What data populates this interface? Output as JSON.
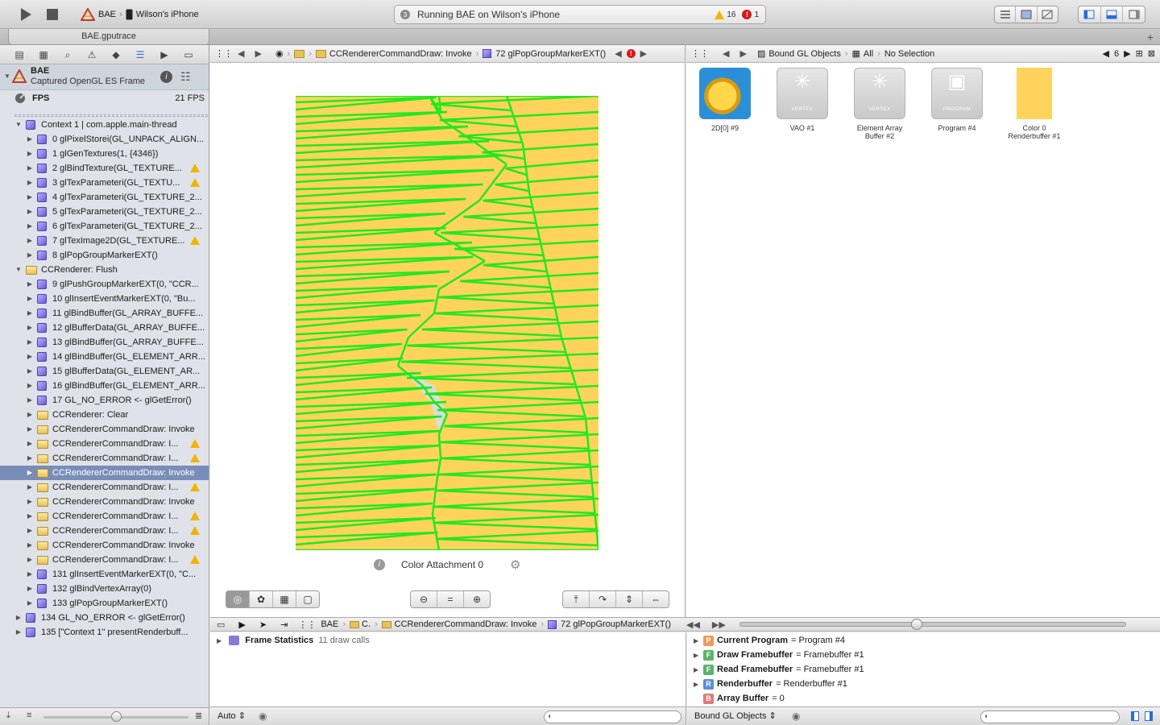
{
  "toolbar": {
    "scheme": "BAE",
    "device": "Wilson's iPhone",
    "activity": "Running BAE on Wilson's iPhone",
    "warnings": "16",
    "errors": "1"
  },
  "tab": {
    "title": "BAE.gputrace"
  },
  "navigator": {
    "app_name": "BAE",
    "subtitle": "Captured OpenGL ES Frame",
    "fps_label": "FPS",
    "fps_value": "21 FPS",
    "rows": [
      {
        "indent": 1,
        "kind": "context",
        "label": "Context 1 | com.apple.main-thread",
        "open": true
      },
      {
        "indent": 2,
        "kind": "call",
        "label": "0 glPixelStorei(GL_UNPACK_ALIGN...",
        "warn": false
      },
      {
        "indent": 2,
        "kind": "call",
        "label": "1 glGenTextures(1, {4346})",
        "warn": false
      },
      {
        "indent": 2,
        "kind": "call",
        "label": "2 glBindTexture(GL_TEXTURE...",
        "warn": true
      },
      {
        "indent": 2,
        "kind": "call",
        "label": "3 glTexParameteri(GL_TEXTU...",
        "warn": true
      },
      {
        "indent": 2,
        "kind": "call",
        "label": "4 glTexParameteri(GL_TEXTURE_2...",
        "warn": false
      },
      {
        "indent": 2,
        "kind": "call",
        "label": "5 glTexParameteri(GL_TEXTURE_2...",
        "warn": false
      },
      {
        "indent": 2,
        "kind": "call",
        "label": "6 glTexParameteri(GL_TEXTURE_2...",
        "warn": false
      },
      {
        "indent": 2,
        "kind": "call",
        "label": "7 glTexImage2D(GL_TEXTURE...",
        "warn": true
      },
      {
        "indent": 2,
        "kind": "call",
        "label": "8 glPopGroupMarkerEXT()",
        "warn": false
      },
      {
        "indent": 1,
        "kind": "group",
        "label": "CCRenderer: Flush",
        "open": true
      },
      {
        "indent": 2,
        "kind": "call",
        "label": "9 glPushGroupMarkerEXT(0, \"CCR...",
        "warn": false
      },
      {
        "indent": 2,
        "kind": "call",
        "label": "10 glInsertEventMarkerEXT(0, \"Bu...",
        "warn": false
      },
      {
        "indent": 2,
        "kind": "call",
        "label": "11 glBindBuffer(GL_ARRAY_BUFFE...",
        "warn": false
      },
      {
        "indent": 2,
        "kind": "call",
        "label": "12 glBufferData(GL_ARRAY_BUFFE...",
        "warn": false
      },
      {
        "indent": 2,
        "kind": "call",
        "label": "13 glBindBuffer(GL_ARRAY_BUFFE...",
        "warn": false
      },
      {
        "indent": 2,
        "kind": "call",
        "label": "14 glBindBuffer(GL_ELEMENT_ARR...",
        "warn": false
      },
      {
        "indent": 2,
        "kind": "call",
        "label": "15 glBufferData(GL_ELEMENT_AR...",
        "warn": false
      },
      {
        "indent": 2,
        "kind": "call",
        "label": "16 glBindBuffer(GL_ELEMENT_ARR...",
        "warn": false
      },
      {
        "indent": 2,
        "kind": "call",
        "label": "17 GL_NO_ERROR <- glGetError()",
        "warn": false
      },
      {
        "indent": 2,
        "kind": "group",
        "label": "CCRenderer: Clear",
        "warn": false
      },
      {
        "indent": 2,
        "kind": "group",
        "label": "CCRendererCommandDraw: Invoke",
        "warn": false
      },
      {
        "indent": 2,
        "kind": "group",
        "label": "CCRendererCommandDraw: I...",
        "warn": true
      },
      {
        "indent": 2,
        "kind": "group",
        "label": "CCRendererCommandDraw: I...",
        "warn": true
      },
      {
        "indent": 2,
        "kind": "group",
        "label": "CCRendererCommandDraw: Invoke",
        "warn": false,
        "selected": true
      },
      {
        "indent": 2,
        "kind": "group",
        "label": "CCRendererCommandDraw: I...",
        "warn": true
      },
      {
        "indent": 2,
        "kind": "group",
        "label": "CCRendererCommandDraw: Invoke",
        "warn": false
      },
      {
        "indent": 2,
        "kind": "group",
        "label": "CCRendererCommandDraw: I...",
        "warn": true
      },
      {
        "indent": 2,
        "kind": "group",
        "label": "CCRendererCommandDraw: I...",
        "warn": true
      },
      {
        "indent": 2,
        "kind": "group",
        "label": "CCRendererCommandDraw: Invoke",
        "warn": false
      },
      {
        "indent": 2,
        "kind": "group",
        "label": "CCRendererCommandDraw: I...",
        "warn": true
      },
      {
        "indent": 2,
        "kind": "call",
        "label": "131 glInsertEventMarkerEXT(0, \"C...",
        "warn": false
      },
      {
        "indent": 2,
        "kind": "call",
        "label": "132 glBindVertexArray(0)",
        "warn": false
      },
      {
        "indent": 2,
        "kind": "call",
        "label": "133 glPopGroupMarkerEXT()",
        "warn": false
      },
      {
        "indent": 1,
        "kind": "call",
        "label": "134 GL_NO_ERROR <- glGetError()",
        "warn": false
      },
      {
        "indent": 1,
        "kind": "call",
        "label": "135 [\"Context 1\" presentRenderbuff...",
        "warn": false
      }
    ]
  },
  "framebuffer": {
    "jump": [
      "CCRendererCommandDraw: Invoke",
      "72 glPopGroupMarkerEXT()"
    ],
    "attachment_label": "Color Attachment 0",
    "fill_color": "#ffd35c",
    "mesh_color": "#22e81f",
    "hole_color": "#dcdcdc"
  },
  "bound": {
    "jump_title": "Bound GL Objects",
    "jump_all": "All",
    "jump_selection": "No Selection",
    "count": "6",
    "objects": [
      {
        "label": "2D[0] #9",
        "kind": "texture",
        "badge": ""
      },
      {
        "label": "VAO #1",
        "kind": "vertex",
        "badge": "VERTEX"
      },
      {
        "label": "Element Array Buffer #2",
        "kind": "vertex",
        "badge": "VERTEX"
      },
      {
        "label": "Program #4",
        "kind": "program",
        "badge": "PROGRAM"
      },
      {
        "label": "Color 0 Renderbuffer #1",
        "kind": "renderbuffer",
        "badge": ""
      }
    ]
  },
  "debugbar": {
    "crumbs": [
      "BAE",
      "C.",
      "CCRendererCommandDraw: Invoke",
      "72 glPopGroupMarkerEXT()"
    ]
  },
  "stats": {
    "title": "Frame Statistics",
    "detail": "11 draw calls"
  },
  "state": [
    {
      "badge": "P",
      "color": "#f09a5a",
      "name": "Current Program",
      "value": "= Program #4",
      "expand": true
    },
    {
      "badge": "F",
      "color": "#5bb36a",
      "name": "Draw Framebuffer",
      "value": "= Framebuffer #1",
      "expand": true
    },
    {
      "badge": "F",
      "color": "#5bb36a",
      "name": "Read Framebuffer",
      "value": "= Framebuffer #1",
      "expand": true
    },
    {
      "badge": "R",
      "color": "#5b8fd8",
      "name": "Renderbuffer",
      "value": "= Renderbuffer #1",
      "expand": true
    },
    {
      "badge": "B",
      "color": "#e07a7a",
      "name": "Array Buffer",
      "value": "= 0",
      "expand": false
    }
  ],
  "bottombar": {
    "auto_label": "Auto",
    "bound_label": "Bound GL Objects"
  }
}
